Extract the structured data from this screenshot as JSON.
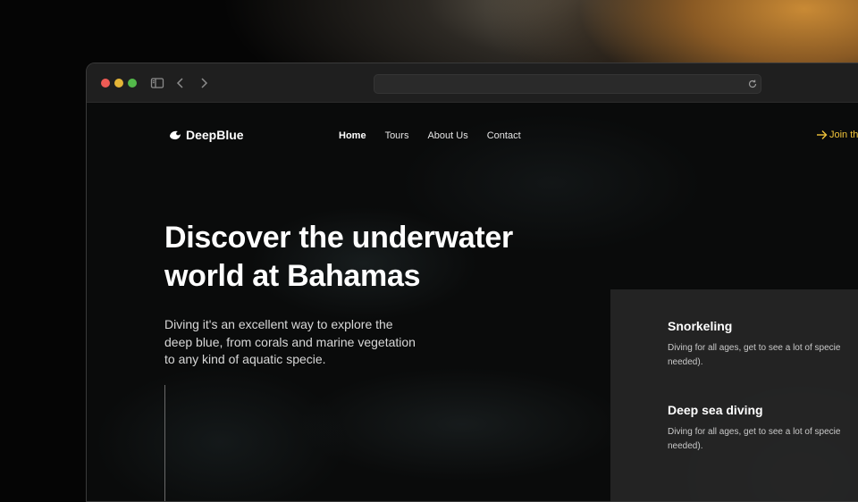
{
  "browser": {
    "address": ""
  },
  "site": {
    "brand": "DeepBlue",
    "nav": [
      {
        "label": "Home",
        "active": true
      },
      {
        "label": "Tours",
        "active": false
      },
      {
        "label": "About Us",
        "active": false
      },
      {
        "label": "Contact",
        "active": false
      }
    ],
    "cta_label": "Join th",
    "accent_color": "#f1c43a"
  },
  "hero": {
    "title": "Discover the underwater world at Bahamas",
    "description": "Diving it's an excellent way to explore the deep blue, from corals and marine vegetation to any kind of aquatic specie."
  },
  "activities": [
    {
      "title": "Snorkeling",
      "description_line1": "Diving for all ages, get to see a lot of specie",
      "description_line2": "needed)."
    },
    {
      "title": "Deep sea diving",
      "description_line1": "Diving for all ages, get to see a lot of specie",
      "description_line2": "needed)."
    }
  ]
}
